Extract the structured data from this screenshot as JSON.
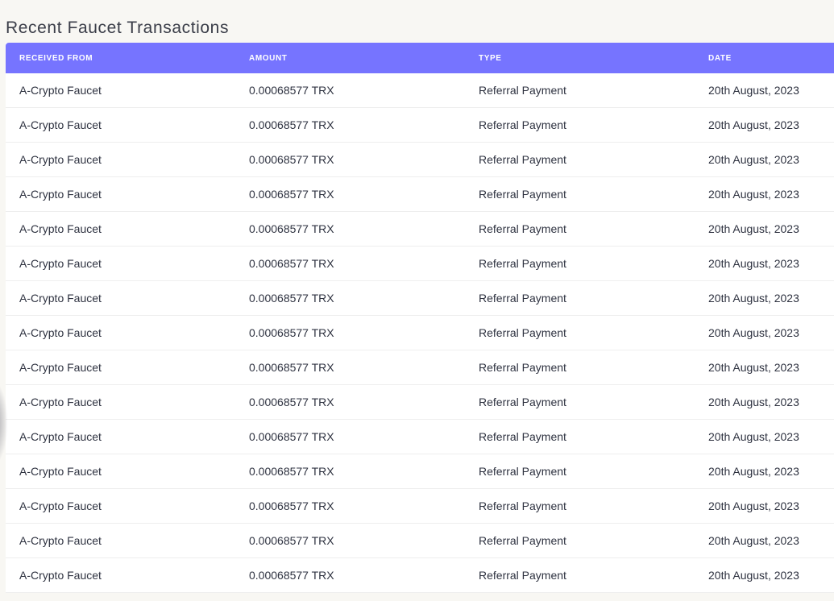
{
  "page": {
    "title": "Recent Faucet Transactions"
  },
  "table": {
    "columns": [
      "Received From",
      "Amount",
      "Type",
      "Date"
    ],
    "rows": [
      {
        "from": "A-Crypto Faucet",
        "amount": "0.00068577 TRX",
        "type": "Referral Payment",
        "date": "20th August, 2023"
      },
      {
        "from": "A-Crypto Faucet",
        "amount": "0.00068577 TRX",
        "type": "Referral Payment",
        "date": "20th August, 2023"
      },
      {
        "from": "A-Crypto Faucet",
        "amount": "0.00068577 TRX",
        "type": "Referral Payment",
        "date": "20th August, 2023"
      },
      {
        "from": "A-Crypto Faucet",
        "amount": "0.00068577 TRX",
        "type": "Referral Payment",
        "date": "20th August, 2023"
      },
      {
        "from": "A-Crypto Faucet",
        "amount": "0.00068577 TRX",
        "type": "Referral Payment",
        "date": "20th August, 2023"
      },
      {
        "from": "A-Crypto Faucet",
        "amount": "0.00068577 TRX",
        "type": "Referral Payment",
        "date": "20th August, 2023"
      },
      {
        "from": "A-Crypto Faucet",
        "amount": "0.00068577 TRX",
        "type": "Referral Payment",
        "date": "20th August, 2023"
      },
      {
        "from": "A-Crypto Faucet",
        "amount": "0.00068577 TRX",
        "type": "Referral Payment",
        "date": "20th August, 2023"
      },
      {
        "from": "A-Crypto Faucet",
        "amount": "0.00068577 TRX",
        "type": "Referral Payment",
        "date": "20th August, 2023"
      },
      {
        "from": "A-Crypto Faucet",
        "amount": "0.00068577 TRX",
        "type": "Referral Payment",
        "date": "20th August, 2023"
      },
      {
        "from": "A-Crypto Faucet",
        "amount": "0.00068577 TRX",
        "type": "Referral Payment",
        "date": "20th August, 2023"
      },
      {
        "from": "A-Crypto Faucet",
        "amount": "0.00068577 TRX",
        "type": "Referral Payment",
        "date": "20th August, 2023"
      },
      {
        "from": "A-Crypto Faucet",
        "amount": "0.00068577 TRX",
        "type": "Referral Payment",
        "date": "20th August, 2023"
      },
      {
        "from": "A-Crypto Faucet",
        "amount": "0.00068577 TRX",
        "type": "Referral Payment",
        "date": "20th August, 2023"
      },
      {
        "from": "A-Crypto Faucet",
        "amount": "0.00068577 TRX",
        "type": "Referral Payment",
        "date": "20th August, 2023"
      }
    ]
  },
  "colors": {
    "header_bg": "#7674ff",
    "page_bg": "#f8f7f3"
  }
}
